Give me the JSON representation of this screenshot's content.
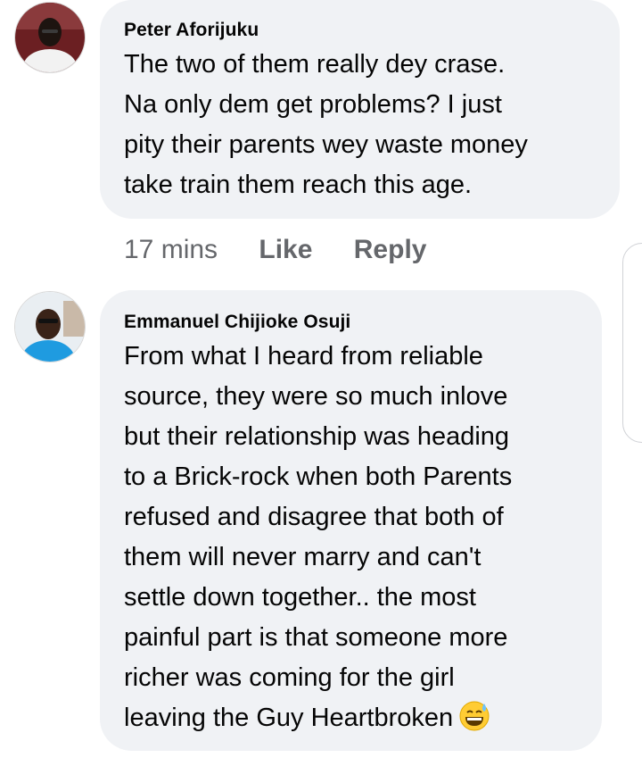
{
  "comments": [
    {
      "author": "Peter Aforijuku",
      "avatar_icon": "profile-photo",
      "lines": [
        "The two of them really dey crase.",
        "Na only dem get problems? I just",
        "pity their parents wey waste money",
        "take train them reach this age."
      ],
      "time": "17 mins",
      "like_label": "Like",
      "reply_label": "Reply"
    },
    {
      "author": "Emmanuel Chijioke Osuji",
      "avatar_icon": "profile-photo",
      "lines": [
        "From what I heard from reliable",
        "source, they were so much inlove",
        "but their relationship was heading",
        "to a Brick-rock when both Parents",
        "refused and disagree that both of",
        "them will never marry and can't",
        "settle down together.. the most",
        "painful part is that someone more",
        "richer was coming for the girl",
        "leaving the Guy Heartbroken"
      ],
      "emoji": "grinning-sweat-emoji"
    }
  ],
  "colors": {
    "bubble": "#f0f2f5",
    "text": "#050505",
    "meta": "#65676b"
  }
}
